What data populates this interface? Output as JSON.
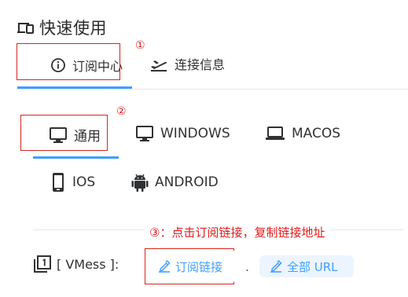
{
  "header": {
    "title": "快速使用",
    "icon": "devices-icon"
  },
  "top_tabs": [
    {
      "label": "订阅中心",
      "icon": "info-circle-icon",
      "active": true
    },
    {
      "label": "连接信息",
      "icon": "flight-takeoff-icon",
      "active": false
    }
  ],
  "platforms": [
    {
      "label": "通用",
      "icon": "monitor-icon",
      "active": true
    },
    {
      "label": "WINDOWS",
      "icon": "monitor-icon",
      "active": false
    },
    {
      "label": "MACOS",
      "icon": "laptop-icon",
      "active": false
    },
    {
      "label": "IOS",
      "icon": "phone-icon",
      "active": false
    },
    {
      "label": "ANDROID",
      "icon": "android-icon",
      "active": false
    }
  ],
  "markers": {
    "m1": "①",
    "m2": "②",
    "m3": "③：点击订阅链接，复制链接地址"
  },
  "vmess": {
    "label": "[ VMess ]:",
    "sub_link_label": "订阅链接",
    "separator": ".",
    "all_url_label": "全部 URL"
  },
  "colors": {
    "accent": "#409eff",
    "annotation": "#e21b1b",
    "button_bg": "#ecf5ff"
  }
}
